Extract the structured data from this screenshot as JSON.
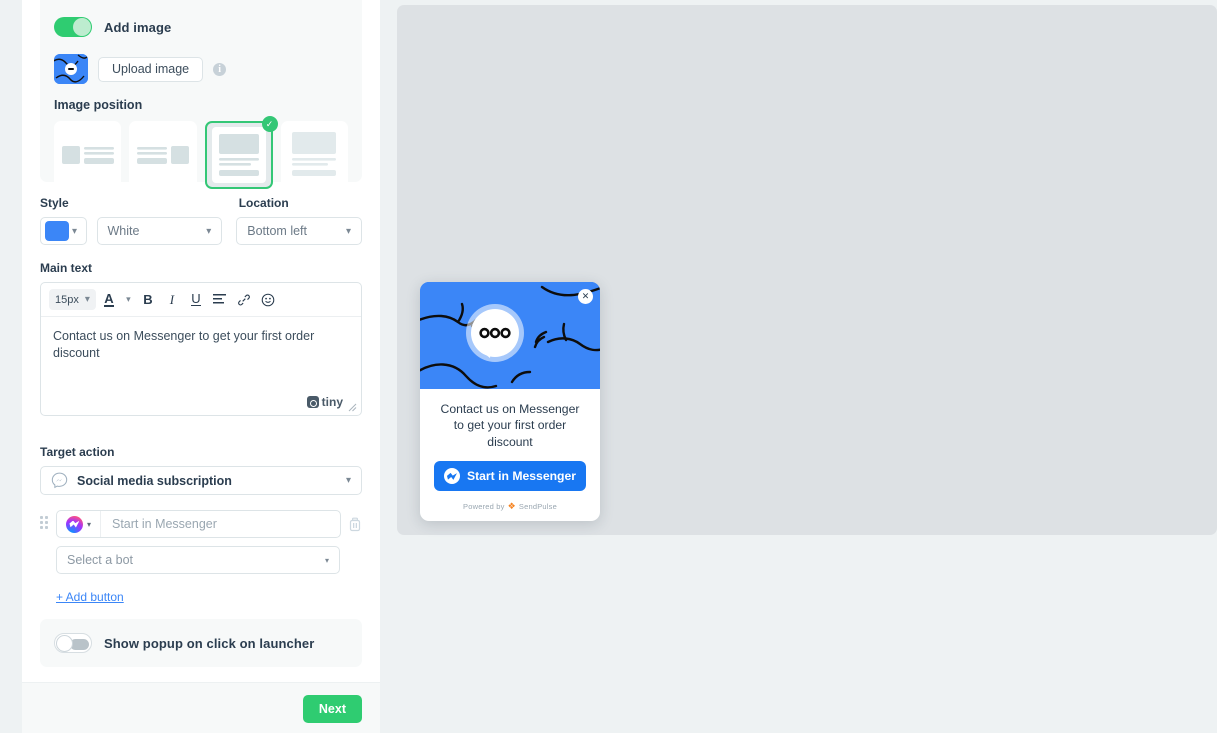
{
  "editor": {
    "add_image": {
      "toggle_label": "Add image",
      "toggle_state": "on",
      "upload_button": "Upload image",
      "info_tooltip_icon": "info-icon"
    },
    "image_position": {
      "label": "Image position",
      "options": [
        {
          "name": "left-image",
          "selected": false
        },
        {
          "name": "right-image",
          "selected": false
        },
        {
          "name": "top-image",
          "selected": true
        },
        {
          "name": "full-image",
          "selected": false
        }
      ]
    },
    "style": {
      "label": "Style",
      "color_value": "#3b86f7",
      "theme_value": "White"
    },
    "location": {
      "label": "Location",
      "value": "Bottom left"
    },
    "main_text": {
      "label": "Main text",
      "font_size": "15px",
      "toolbar": [
        "text-color-icon",
        "bold-icon",
        "italic-icon",
        "underline-icon",
        "align-icon",
        "link-icon",
        "emoji-icon"
      ],
      "content": "Contact us on Messenger to get your first order discount",
      "branding": "tiny"
    },
    "target_action": {
      "label": "Target action",
      "value": "Social media subscription",
      "button": {
        "channel_icon": "messenger-icon",
        "placeholder": "Start in Messenger",
        "value": "",
        "delete_icon": "trash-icon"
      },
      "bot_select": {
        "placeholder": "Select a bot",
        "value": ""
      },
      "add_button_link": "+ Add button"
    },
    "show_popup": {
      "toggle_label": "Show popup on click on launcher",
      "toggle_state": "off"
    },
    "footer": {
      "next_label": "Next"
    }
  },
  "preview": {
    "close_icon": "close-icon",
    "hero_bg": "#3b86f7",
    "text": "Contact us on Messenger to get your first order discount",
    "cta_label": "Start in Messenger",
    "cta_bg": "#1877f2",
    "powered_prefix": "Powered by",
    "powered_brand": "SendPulse"
  }
}
